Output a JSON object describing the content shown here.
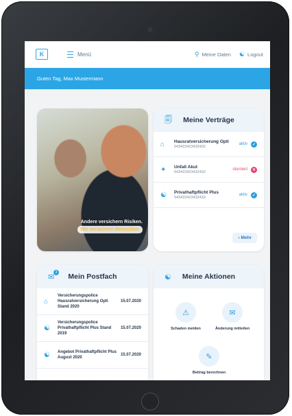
{
  "topbar": {
    "logo": "K",
    "menu_label": "Menü",
    "my_data_label": "Meine Daten",
    "logout_label": "Logout"
  },
  "greeting": "Guten Tag, Max Mustermann",
  "hero": {
    "line1": "Andere versichern Risiken.",
    "line2": "Wir versichern Menschen."
  },
  "contracts": {
    "title": "Meine Verträge",
    "items": [
      {
        "name": "Hausratversicherung Opti",
        "number": "543423423432432",
        "status": "aktiv",
        "status_color": "#2b9fe0"
      },
      {
        "name": "Unfall Akut",
        "number": "543423423432432",
        "status": "storniert",
        "status_color": "#e5426a"
      },
      {
        "name": "Privathaftpflicht Plus",
        "number": "543423423432432",
        "status": "aktiv",
        "status_color": "#2b9fe0"
      }
    ],
    "more_label": "Mehr"
  },
  "mailbox": {
    "title": "Mein Postfach",
    "badge": "3",
    "items": [
      {
        "text": "Versicherungspolice Hausratversicherung Opti Stand 2020",
        "date": "15.07.2020"
      },
      {
        "text": "Versicherungspolice Privathaftpflicht Plus Stand 2019",
        "date": "15.07.2020"
      },
      {
        "text": "Angebot Privathaftpflicht Plus August 2020",
        "date": "15.07.2020"
      }
    ]
  },
  "actions": {
    "title": "Meine Aktionen",
    "items": [
      {
        "label": "Schaden melden",
        "icon": "warning-icon"
      },
      {
        "label": "Änderung mitteilen",
        "icon": "envelope-icon"
      },
      {
        "label": "Beitrag berechnen",
        "icon": "pencil-icon"
      }
    ]
  }
}
